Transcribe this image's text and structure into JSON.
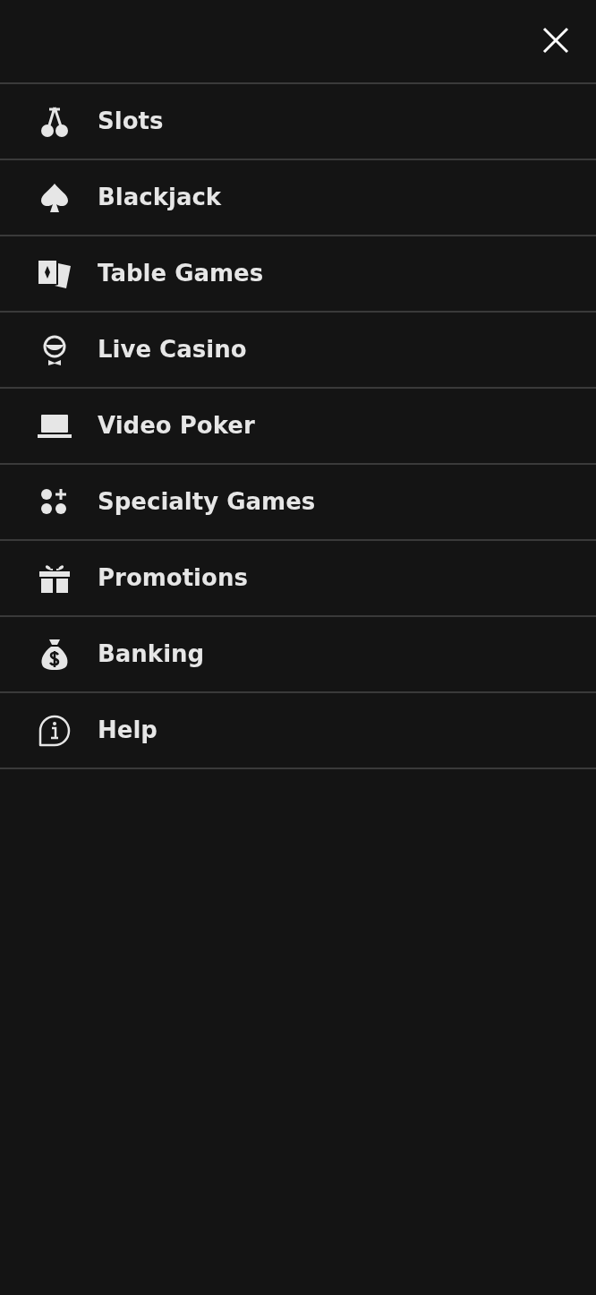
{
  "menu": {
    "items": [
      {
        "label": "Slots",
        "kind": "cherries"
      },
      {
        "label": "Blackjack",
        "kind": "spade"
      },
      {
        "label": "Table Games",
        "kind": "cards"
      },
      {
        "label": "Live Casino",
        "kind": "dealer"
      },
      {
        "label": "Video Poker",
        "kind": "laptop"
      },
      {
        "label": "Specialty Games",
        "kind": "dots"
      },
      {
        "label": "Promotions",
        "kind": "gift"
      },
      {
        "label": "Banking",
        "kind": "moneybag"
      },
      {
        "label": "Help",
        "kind": "info"
      }
    ]
  }
}
